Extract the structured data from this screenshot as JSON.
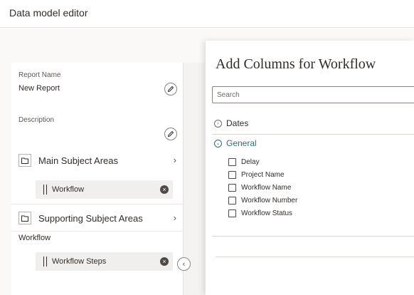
{
  "header": {
    "title": "Data model editor"
  },
  "left_panel": {
    "report_name_label": "Report Name",
    "report_name_value": "New Report",
    "description_label": "Description",
    "main_subject_areas": {
      "label": "Main Subject Areas",
      "chip": "Workflow"
    },
    "supporting_subject_areas": {
      "label": "Supporting Subject Areas",
      "sublabel": "Workflow",
      "chip": "Workflow Steps"
    }
  },
  "drawer": {
    "title": "Add Columns for Workflow",
    "search_placeholder": "Search",
    "groups": [
      {
        "label": "Dates",
        "expanded": false
      },
      {
        "label": "General",
        "expanded": true
      }
    ],
    "columns": [
      "Delay",
      "Project Name",
      "Workflow Name",
      "Workflow Number",
      "Workflow Status"
    ]
  },
  "colors": {
    "accent": "#2f6f7a",
    "text": "#312d2a",
    "panel_bg": "#fbf9f8"
  }
}
